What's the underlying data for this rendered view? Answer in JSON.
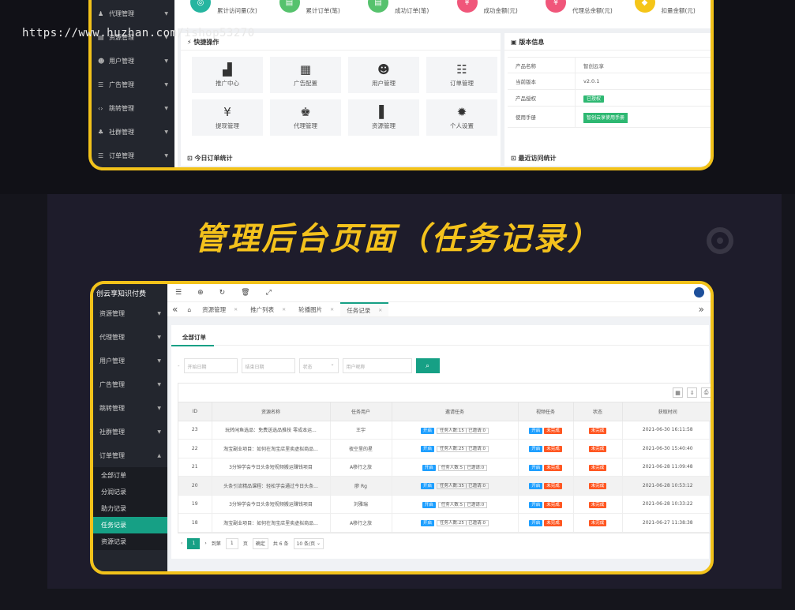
{
  "watermark": "https://www.huzhan.com/ishop53270",
  "headline": "管理后台页面（任务记录）",
  "panel1": {
    "sidebar": [
      {
        "icon": "user-group-icon",
        "glyph": "♟",
        "label": "代理管理"
      },
      {
        "icon": "folder-icon",
        "glyph": "▤",
        "label": "资源管理"
      },
      {
        "icon": "user-icon",
        "glyph": "☻",
        "label": "用户管理"
      },
      {
        "icon": "list-icon",
        "glyph": "☰",
        "label": "广告管理"
      },
      {
        "icon": "code-icon",
        "glyph": "‹›",
        "label": "跳转管理"
      },
      {
        "icon": "group-icon",
        "glyph": "♣",
        "label": "社群管理"
      },
      {
        "icon": "order-icon",
        "glyph": "☰",
        "label": "订单管理"
      }
    ],
    "stats": [
      {
        "label": "累计访问量(次)",
        "color": "#26b5a0",
        "glyph": "◎"
      },
      {
        "label": "累计订单(笔)",
        "color": "#56c26d",
        "glyph": "▤"
      },
      {
        "label": "成功订单(笔)",
        "color": "#56c26d",
        "glyph": "▤"
      },
      {
        "label": "成功金额(元)",
        "color": "#f0567a",
        "glyph": "¥"
      },
      {
        "label": "代理总余额(元)",
        "color": "#f0567a",
        "glyph": "¥"
      },
      {
        "label": "扣量金额(元)",
        "color": "#f5c518",
        "glyph": "◆"
      }
    ],
    "quick_title": "快捷操作",
    "quick": [
      {
        "icon": "chart-icon",
        "glyph": "▟",
        "label": "推广中心"
      },
      {
        "icon": "grid-icon",
        "glyph": "▦",
        "label": "广告配置"
      },
      {
        "icon": "user-icon",
        "glyph": "☻",
        "label": "用户管理"
      },
      {
        "icon": "order-list-icon",
        "glyph": "☷",
        "label": "订单管理"
      },
      {
        "icon": "withdraw-icon",
        "glyph": "¥",
        "label": "提现管理"
      },
      {
        "icon": "agent-icon",
        "glyph": "♚",
        "label": "代理管理"
      },
      {
        "icon": "book-icon",
        "glyph": "▌",
        "label": "资源管理"
      },
      {
        "icon": "gear-icon",
        "glyph": "✹",
        "label": "个人设置"
      }
    ],
    "version_title": "版本信息",
    "version_rows": [
      {
        "k": "产品名称",
        "v": "智创云享"
      },
      {
        "k": "当前版本",
        "v": "v2.0.1"
      },
      {
        "k": "产品授权",
        "badge": "已授权"
      },
      {
        "k": "使用手册",
        "button": "智创云享使用手册"
      }
    ],
    "today_title": "今日订单统计",
    "visit_title": "最近访问统计"
  },
  "panel2": {
    "brand": "创云享知识付费",
    "sidebar": [
      "资源管理",
      "代理管理",
      "用户管理",
      "广告管理",
      "跳转管理",
      "社群管理",
      "订单管理"
    ],
    "submenu": [
      "全部订单",
      "分润记录",
      "助力记录",
      "任务记录",
      "资源记录"
    ],
    "active_sub": "任务记录",
    "tabs": [
      "资源管理",
      "推广列表",
      "轮播图片",
      "任务记录"
    ],
    "card_title": "全部订单",
    "filters": [
      "开始日期",
      "结束日期",
      "状态",
      "用户昵称"
    ],
    "columns": [
      "ID",
      "资源名称",
      "任务用户",
      "邀请任务",
      "视频任务",
      "状态",
      "获取时间"
    ],
    "rows": [
      {
        "id": "23",
        "name": "玩转闲鱼选品：免费送选品推技 零成本运...",
        "user": "王宇",
        "invite": "任务人数:15 | 已邀请:0",
        "video": "未完成",
        "status": "未完成",
        "time": "2021-06-30 16:11:58"
      },
      {
        "id": "22",
        "name": "淘宝副业项目：如何在淘宝店里卖虚拟商品...",
        "user": "夜空里的星",
        "invite": "任务人数:25 | 已邀请:0",
        "video": "未完成",
        "status": "未完成",
        "time": "2021-06-30 15:40:40"
      },
      {
        "id": "21",
        "name": "3分钟学会今日头条短视频搬运赚钱项目",
        "user": "A移行之旅",
        "invite": "任务人数:5 | 已邀请:0",
        "video": "未完成",
        "status": "未完成",
        "time": "2021-06-28 11:09:48"
      },
      {
        "id": "20",
        "name": "头条引流精品课程：轻松学会通过今日头条...",
        "user": "廖 Rg",
        "invite": "任务人数:35 | 已邀请:0",
        "video": "未完成",
        "status": "未完成",
        "time": "2021-06-28 10:53:12"
      },
      {
        "id": "19",
        "name": "3分钟学会今日头条短视频搬运赚钱项目",
        "user": "刘雅瑞",
        "invite": "任务人数:5 | 已邀请:0",
        "video": "未完成",
        "status": "未完成",
        "time": "2021-06-28 10:33:22"
      },
      {
        "id": "18",
        "name": "淘宝副业项目：如何在淘宝店里卖虚拟商品...",
        "user": "A移行之旅",
        "invite": "任务人数:25 | 已邀请:0",
        "video": "未完成",
        "status": "未完成",
        "time": "2021-06-27 11:38:38"
      }
    ],
    "open_label": "开启",
    "pager": {
      "current": "1",
      "goto_label": "到第",
      "page_input": "1",
      "page_unit": "页",
      "confirm": "确定",
      "total": "共 6 条",
      "per_page": "10 条/页"
    }
  },
  "colors": {
    "accent": "#16a085",
    "frame": "#f2c21a",
    "blue": "#1e9fff",
    "orange": "#ff5722"
  }
}
